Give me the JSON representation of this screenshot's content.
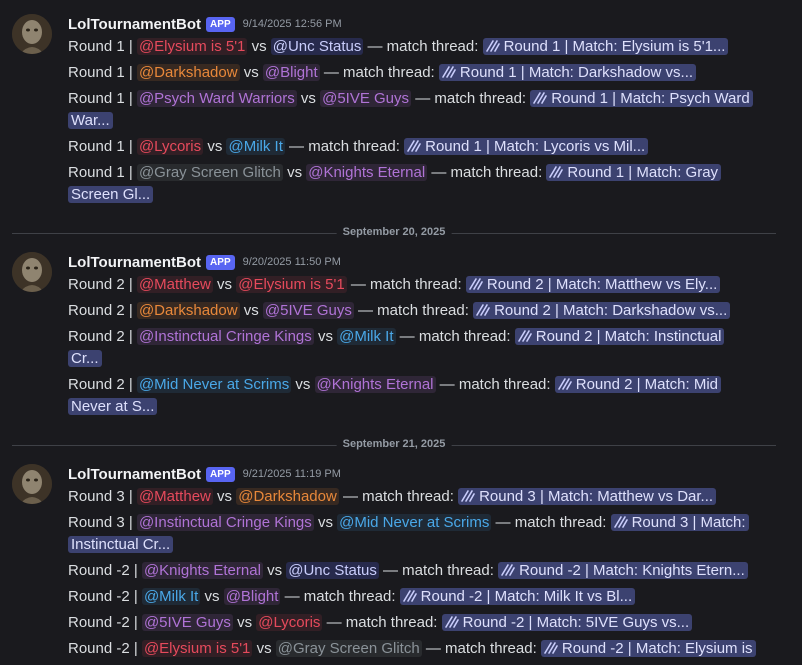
{
  "author": "LolTournamentBot",
  "badge": "APP",
  "dividers": [
    "September 20, 2025",
    "September 21, 2025"
  ],
  "messages": [
    {
      "timestamp": "9/14/2025 12:56 PM",
      "lines": [
        {
          "prefix": "Round 1 |",
          "t1": "@Elysium is 5'1",
          "vs": "vs",
          "t2": "@Unc Status",
          "mid": "— match thread:",
          "thread": "Round 1 | Match: Elysium is 5'1...",
          "cont": ""
        },
        {
          "prefix": "Round 1 |",
          "t1": "@Darkshadow",
          "vs": "vs",
          "t2": "@Blight",
          "mid": "— match thread:",
          "thread": "Round 1 | Match: Darkshadow vs...",
          "cont": ""
        },
        {
          "prefix": "Round 1 |",
          "t1": "@Psych Ward Warriors",
          "vs": "vs",
          "t2": "@5IVE Guys",
          "mid": "— match thread:",
          "thread": "Round 1 | Match: Psych Ward",
          "cont": "War..."
        },
        {
          "prefix": "Round 1 |",
          "t1": "@Lycoris",
          "vs": "vs",
          "t2": "@Milk It",
          "mid": "— match thread:",
          "thread": "Round 1 | Match: Lycoris vs Mil...",
          "cont": ""
        },
        {
          "prefix": "Round 1 |",
          "t1": "@Gray Screen Glitch",
          "vs": "vs",
          "t2": "@Knights Eternal",
          "mid": "— match thread:",
          "thread": "Round 1 | Match: Gray",
          "cont": "Screen Gl..."
        }
      ]
    },
    {
      "timestamp": "9/20/2025 11:50 PM",
      "lines": [
        {
          "prefix": "Round 2 |",
          "t1": "@Matthew",
          "vs": "vs",
          "t2": "@Elysium is 5'1",
          "mid": "— match thread:",
          "thread": "Round 2 | Match: Matthew vs Ely...",
          "cont": ""
        },
        {
          "prefix": "Round 2 |",
          "t1": "@Darkshadow",
          "vs": "vs",
          "t2": "@5IVE Guys",
          "mid": "— match thread:",
          "thread": "Round 2 | Match: Darkshadow vs...",
          "cont": ""
        },
        {
          "prefix": "Round 2 |",
          "t1": "@Instinctual Cringe Kings",
          "vs": "vs",
          "t2": "@Milk It",
          "mid": "— match thread:",
          "thread": "Round 2 | Match: Instinctual",
          "cont": "Cr..."
        },
        {
          "prefix": "Round 2 |",
          "t1": "@Mid Never at Scrims",
          "vs": "vs",
          "t2": "@Knights Eternal",
          "mid": "— match thread:",
          "thread": "Round 2 | Match: Mid",
          "cont": "Never at S..."
        }
      ]
    },
    {
      "timestamp": "9/21/2025 11:19 PM",
      "lines": [
        {
          "prefix": "Round 3 |",
          "t1": "@Matthew",
          "vs": "vs",
          "t2": "@Darkshadow",
          "mid": "— match thread:",
          "thread": "Round 3 | Match: Matthew vs Dar...",
          "cont": ""
        },
        {
          "prefix": "Round 3 |",
          "t1": "@Instinctual Cringe Kings",
          "vs": "vs",
          "t2": "@Mid Never at Scrims",
          "mid": "— match thread:",
          "thread": "Round 3 | Match:",
          "cont": "Instinctual Cr..."
        },
        {
          "prefix": "Round -2 |",
          "t1": "@Knights Eternal",
          "vs": "vs",
          "t2": "@Unc Status",
          "mid": "— match thread:",
          "thread": "Round -2 | Match: Knights Etern...",
          "cont": ""
        },
        {
          "prefix": "Round -2 |",
          "t1": "@Milk It",
          "vs": "vs",
          "t2": "@Blight",
          "mid": "— match thread:",
          "thread": "Round -2 | Match: Milk It vs Bl...",
          "cont": ""
        },
        {
          "prefix": "Round -2 |",
          "t1": "@5IVE Guys",
          "vs": "vs",
          "t2": "@Lycoris",
          "mid": "— match thread:",
          "thread": "Round -2 | Match: 5IVE Guys vs...",
          "cont": ""
        },
        {
          "prefix": "Round -2 |",
          "t1": "@Elysium is 5'1",
          "vs": "vs",
          "t2": "@Gray Screen Glitch",
          "mid": "— match thread:",
          "thread": "Round -2 | Match: Elysium is",
          "cont": ""
        }
      ]
    }
  ],
  "role_colors": {
    "@Elysium is 5'1": "#e64a5c",
    "@Unc Status": "#c9cdfb",
    "@Darkshadow": "#e8883a",
    "@Blight": "#b073d6",
    "@Psych Ward Warriors": "#b073d6",
    "@5IVE Guys": "#b073d6",
    "@Lycoris": "#e64a5c",
    "@Milk It": "#4aa8e8",
    "@Gray Screen Glitch": "#8a9298",
    "@Knights Eternal": "#b073d6",
    "@Matthew": "#e64a5c",
    "@Instinctual Cringe Kings": "#b073d6",
    "@Mid Never at Scrims": "#4aa8e8"
  },
  "colors": {
    "background": "#1a1a1e",
    "badge": "#5865f2",
    "thread_chip": "#3c4270"
  }
}
